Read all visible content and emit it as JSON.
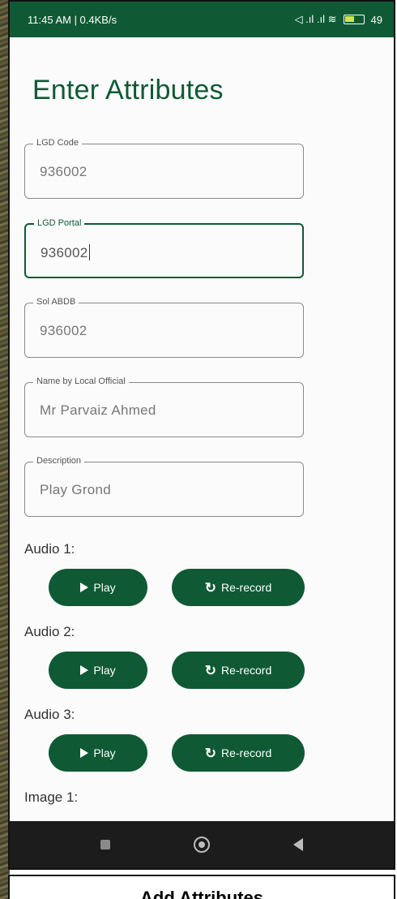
{
  "status_bar": {
    "time_speed": "11:45 AM | 0.4KB/s",
    "icons_text": "◁ .ıl .ıl ≋",
    "battery": "49"
  },
  "page": {
    "title": "Enter Attributes"
  },
  "fields": [
    {
      "label": "LGD Code",
      "value": "936002"
    },
    {
      "label": "LGD Portal",
      "value": "936002"
    },
    {
      "label": "Sol ABDB",
      "value": "936002"
    },
    {
      "label": "Name by Local Official",
      "value": "Mr Parvaiz Ahmed"
    },
    {
      "label": "Description",
      "value": "Play Grond"
    }
  ],
  "audio": [
    {
      "label": "Audio 1:",
      "play": "Play",
      "rerecord": "Re-record"
    },
    {
      "label": "Audio 2:",
      "play": "Play",
      "rerecord": "Re-record"
    },
    {
      "label": "Audio 3:",
      "play": "Play",
      "rerecord": "Re-record"
    }
  ],
  "image_label": "Image 1:",
  "caption": "Add Attributes",
  "colors": {
    "primary": "#0f5a35",
    "nav_bar": "#1c1c1c"
  }
}
